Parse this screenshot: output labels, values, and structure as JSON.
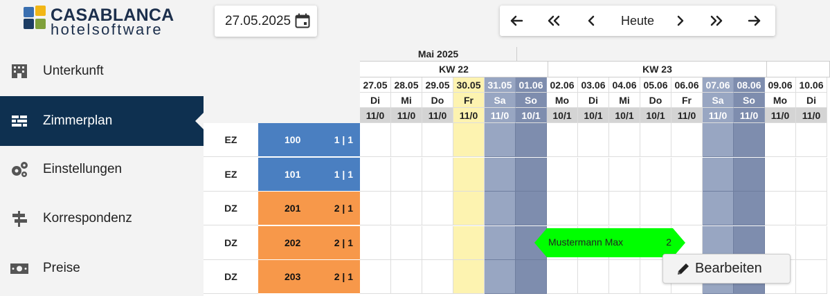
{
  "logo": {
    "title": "CASABLANCA",
    "subtitle": "hotelsoftware"
  },
  "sidebar": {
    "items": [
      {
        "label": "Unterkunft",
        "icon": "building-icon",
        "active": false
      },
      {
        "label": "Zimmerplan",
        "icon": "room-plan-icon",
        "active": true
      },
      {
        "label": "Einstellungen",
        "icon": "gears-icon",
        "active": false
      },
      {
        "label": "Korrespondenz",
        "icon": "signpost-icon",
        "active": false
      },
      {
        "label": "Preise",
        "icon": "money-icon",
        "active": false
      }
    ]
  },
  "toolbar": {
    "date": "27.05.2025",
    "today_label": "Heute",
    "nav_icons": [
      "arrow-left-icon",
      "double-chevron-left-icon",
      "chevron-left-icon",
      "chevron-right-icon",
      "double-chevron-right-icon",
      "arrow-right-icon"
    ]
  },
  "plan": {
    "month": "Mai 2025",
    "weeks": [
      "KW 22",
      "KW 23"
    ],
    "days": [
      {
        "date": "27.05",
        "weekday": "Di",
        "avail": "11/0",
        "kind": "normal"
      },
      {
        "date": "28.05",
        "weekday": "Mi",
        "avail": "11/0",
        "kind": "normal"
      },
      {
        "date": "29.05",
        "weekday": "Do",
        "avail": "11/0",
        "kind": "normal"
      },
      {
        "date": "30.05",
        "weekday": "Fr",
        "avail": "11/0",
        "kind": "today"
      },
      {
        "date": "31.05",
        "weekday": "Sa",
        "avail": "11/0",
        "kind": "sat"
      },
      {
        "date": "01.06",
        "weekday": "So",
        "avail": "10/1",
        "kind": "sun"
      },
      {
        "date": "02.06",
        "weekday": "Mo",
        "avail": "10/1",
        "kind": "normal"
      },
      {
        "date": "03.06",
        "weekday": "Di",
        "avail": "10/1",
        "kind": "normal"
      },
      {
        "date": "04.06",
        "weekday": "Mi",
        "avail": "10/1",
        "kind": "normal"
      },
      {
        "date": "05.06",
        "weekday": "Do",
        "avail": "10/1",
        "kind": "normal"
      },
      {
        "date": "06.06",
        "weekday": "Fr",
        "avail": "11/0",
        "kind": "normal"
      },
      {
        "date": "07.06",
        "weekday": "Sa",
        "avail": "11/0",
        "kind": "sat"
      },
      {
        "date": "08.06",
        "weekday": "So",
        "avail": "11/0",
        "kind": "sun"
      },
      {
        "date": "09.06",
        "weekday": "Mo",
        "avail": "11/0",
        "kind": "normal"
      },
      {
        "date": "10.06",
        "weekday": "Di",
        "avail": "11/0",
        "kind": "normal"
      }
    ],
    "rooms": [
      {
        "type": "EZ",
        "number": "100",
        "capacity": "1 | 1",
        "category": "ez"
      },
      {
        "type": "EZ",
        "number": "101",
        "capacity": "1 | 1",
        "category": "ez"
      },
      {
        "type": "DZ",
        "number": "201",
        "capacity": "2 | 1",
        "category": "dz"
      },
      {
        "type": "DZ",
        "number": "202",
        "capacity": "2 | 1",
        "category": "dz"
      },
      {
        "type": "DZ",
        "number": "203",
        "capacity": "2 | 1",
        "category": "dz"
      }
    ],
    "booking": {
      "guest": "Mustermann Max",
      "persons": "2",
      "room": "202",
      "color": "#00ff00"
    },
    "edit_label": "Bearbeiten"
  },
  "colors": {
    "sidebar_active": "#0e3050",
    "ez_room": "#4a7fc1",
    "dz_room": "#f7984a",
    "today_col": "#fdf3b0",
    "sat_col": "#98a6c2",
    "sun_col": "#7e8dae",
    "header_day": "#ececec",
    "avail": "#d4d4d4"
  }
}
